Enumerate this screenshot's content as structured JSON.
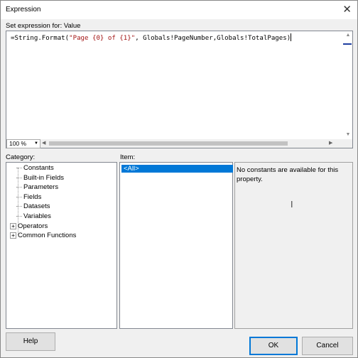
{
  "window": {
    "title": "Expression",
    "close_glyph": "✕"
  },
  "expression": {
    "label": "Set expression for: Value",
    "code_prefix": "=String.Format(",
    "code_string": "\"Page {0} of {1}\"",
    "code_suffix": ", Globals!PageNumber,Globals!TotalPages)"
  },
  "zoom": {
    "value": "100 %"
  },
  "category": {
    "label": "Category:",
    "items": [
      {
        "label": "Constants"
      },
      {
        "label": "Built-in Fields"
      },
      {
        "label": "Parameters"
      },
      {
        "label": "Fields"
      },
      {
        "label": "Datasets"
      },
      {
        "label": "Variables"
      },
      {
        "label": "Operators",
        "expander": "+"
      },
      {
        "label": "Common Functions",
        "expander": "+"
      }
    ]
  },
  "item": {
    "label": "Item:",
    "selected": "<All>"
  },
  "description": {
    "text": "No constants are available for this property."
  },
  "buttons": {
    "help": "Help",
    "ok": "OK",
    "cancel": "Cancel"
  }
}
